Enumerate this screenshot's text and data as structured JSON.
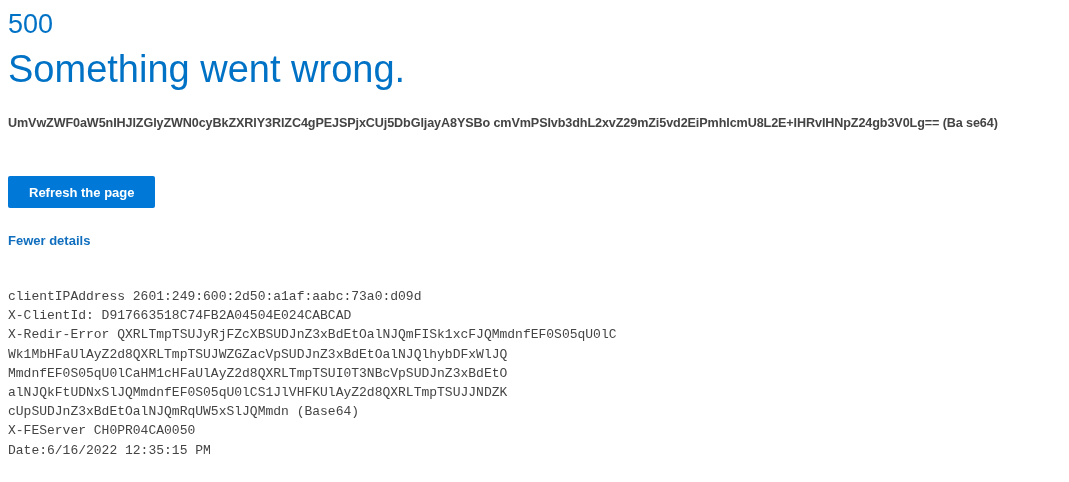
{
  "status_code": "500",
  "title": "Something went wrong.",
  "error_message": "UmVwZWF0aW5nIHJlZGlyZWN0cyBkZXRlY3RlZC4gPEJSPjxCUj5DbGljayA8YSBo cmVmPSIvb3dhL2xvZ29mZi5vd2EiPmhlcmU8L2E+IHRvIHNpZ24gb3V0Lg== (Ba se64)",
  "refresh_button": "Refresh the page",
  "details_link": "Fewer details",
  "details": [
    "clientIPAddress 2601:249:600:2d50:a1af:aabc:73a0:d09d",
    "X-ClientId: D917663518C74FB2A04504E024CABCAD",
    "X-Redir-Error QXRLTmpTSUJyRjFZcXBSUDJnZ3xBdEtOalNJQmFISk1xcFJQMmdnfEF0S05qU0lC",
    "Wk1MbHFaUlAyZ2d8QXRLTmpTSUJWZGZacVpSUDJnZ3xBdEtOalNJQlhybDFxWlJQ",
    "MmdnfEF0S05qU0lCaHM1cHFaUlAyZ2d8QXRLTmpTSUI0T3NBcVpSUDJnZ3xBdEtO",
    "alNJQkFtUDNxSlJQMmdnfEF0S05qU0lCS1JlVHFKUlAyZ2d8QXRLTmpTSUJJNDZK",
    "cUpSUDJnZ3xBdEtOalNJQmRqUW5xSlJQMmdn (Base64)",
    "X-FEServer CH0PR04CA0050",
    "Date:6/16/2022 12:35:15 PM"
  ]
}
